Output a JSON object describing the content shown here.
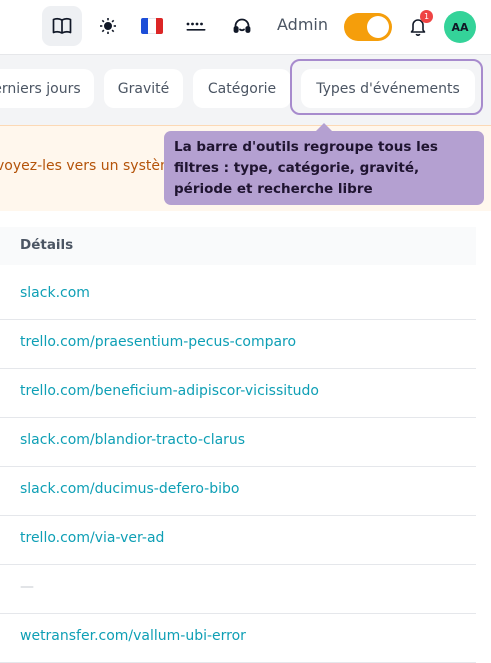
{
  "header": {
    "admin_label": "Admin",
    "notification_count": "1",
    "avatar_initials": "AA",
    "icons": [
      "book-icon",
      "sun-icon",
      "french-flag-icon",
      "password-icon",
      "support-headset-icon",
      "bell-icon"
    ],
    "toggle_on": true,
    "accent_color": "#f59e0b",
    "avatar_color": "#34d399"
  },
  "filters": {
    "items": [
      "erniers jours",
      "Gravité",
      "Catégorie",
      "Types d'événements"
    ]
  },
  "banner": {
    "text": "voyez-les vers un systèm"
  },
  "tooltip": {
    "text": "La barre d'outils regroupe tous les filtres : type, catégorie, gravité, période et recherche libre",
    "color": "#b4a0d1"
  },
  "table": {
    "header": "Détails",
    "rows": [
      "slack.com",
      "trello.com/praesentium-pecus-comparo",
      "trello.com/beneficium-adipiscor-vicissitudo",
      "slack.com/blandior-tracto-clarus",
      "slack.com/ducimus-defero-bibo",
      "trello.com/via-ver-ad",
      "—",
      "wetransfer.com/vallum-ubi-error"
    ],
    "link_color": "#0e9fb5"
  }
}
